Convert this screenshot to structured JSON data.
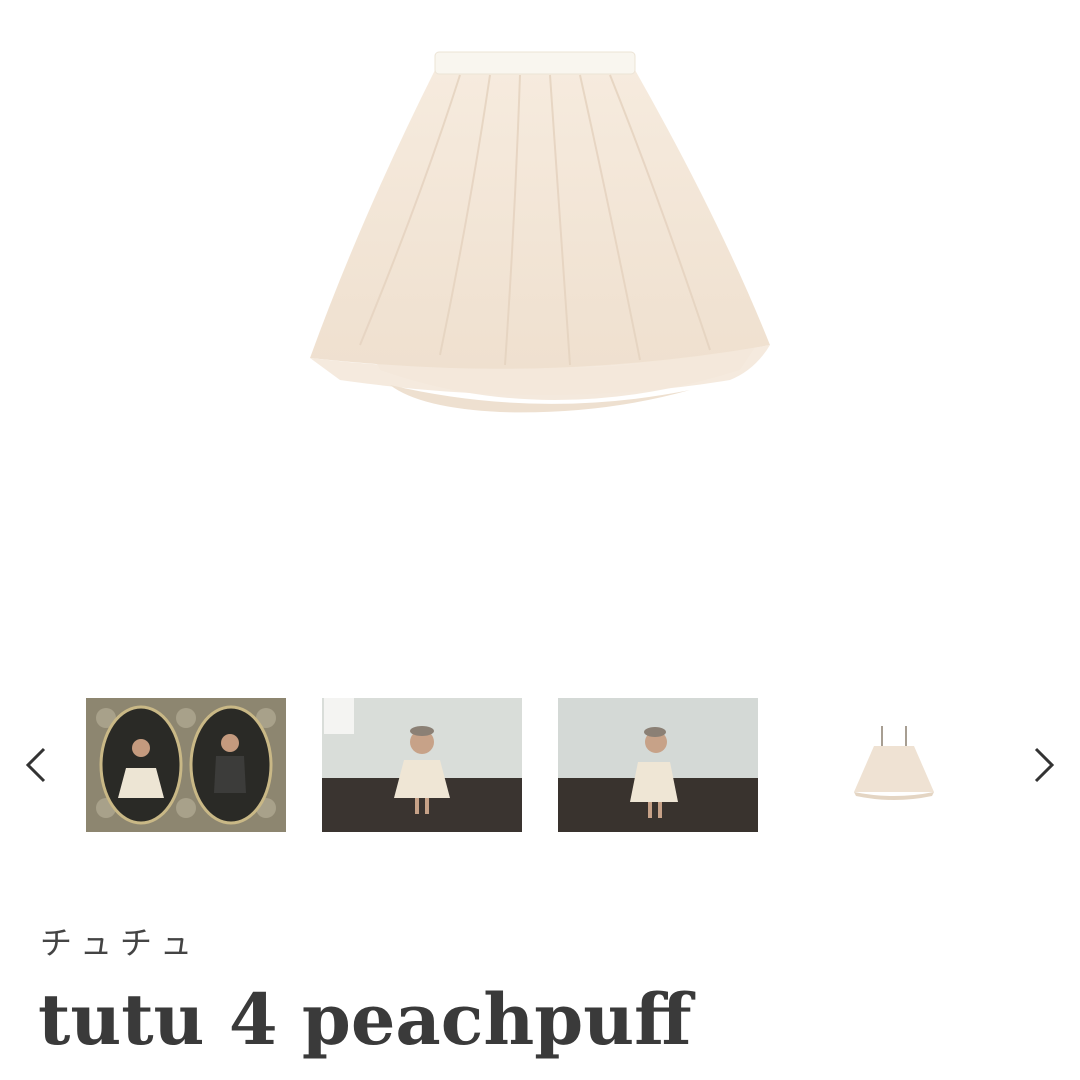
{
  "product": {
    "subtitle": "チュチュ",
    "title": "tutu 4 peachpuff",
    "color": "#f3e6d8"
  },
  "gallery": {
    "main_image": "tutu-skirt-image",
    "prev_icon": "chevron-left-icon",
    "next_icon": "chevron-right-icon",
    "thumbnails": [
      "thumbnail-framed-portraits",
      "thumbnail-child-standing-front",
      "thumbnail-child-standing-side",
      "thumbnail-tutu-dress-product"
    ]
  }
}
